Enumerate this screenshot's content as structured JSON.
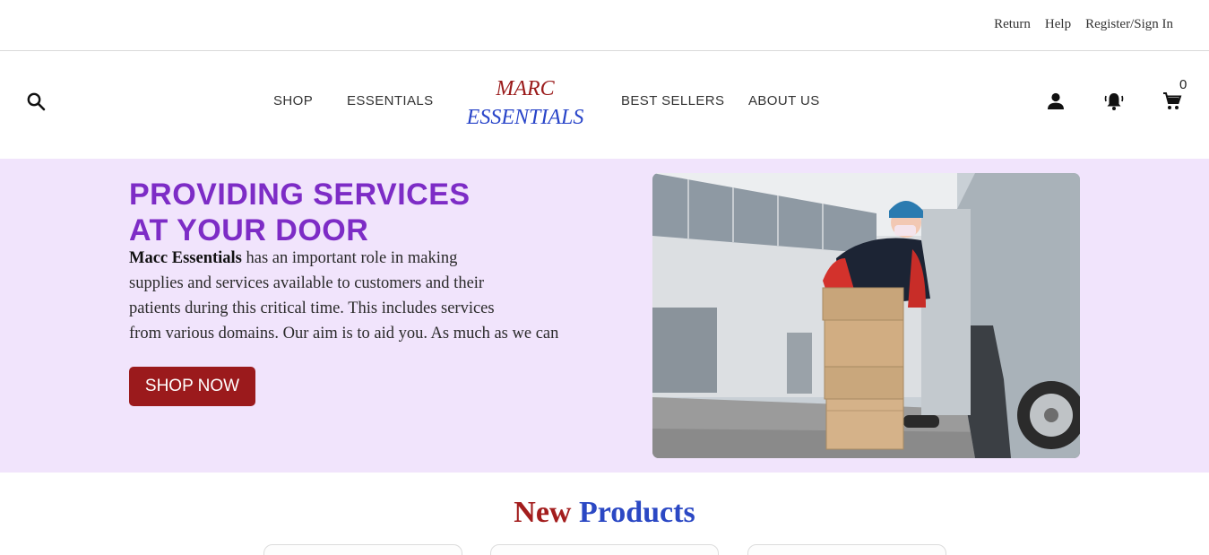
{
  "topbar": {
    "links": [
      "Return",
      "Help",
      "Register/Sign In"
    ]
  },
  "header": {
    "nav": {
      "shop": "SHOP",
      "essentials": "ESSENTIALS",
      "best_sellers": "BEST SELLERS",
      "about_us": "ABOUT US"
    },
    "logo": {
      "line1": "MARC",
      "line2": "ESSENTIALS"
    },
    "cart_count": "0",
    "icons": [
      "search-icon",
      "user-icon",
      "notification-bell-icon",
      "cart-icon"
    ]
  },
  "hero": {
    "title_line1": "PROVIDING SERVICES",
    "title_line2": "AT YOUR DOOR",
    "brand": "Macc Essentials",
    "desc_line1": " has an important role in making",
    "desc_line2": "supplies and services available to customers and their",
    "desc_line3": "patients during this critical time. This includes services",
    "desc_line4": "from various domains. Our aim is to aid you. As much as we can",
    "cta": "SHOP NOW"
  },
  "new_products": {
    "word1": "New",
    "word2": "Products"
  },
  "colors": {
    "brand_red": "#9b1a1c",
    "brand_blue": "#2945c9",
    "hero_purple": "#7d2cc6",
    "hero_bg": "#f1e4fc"
  }
}
